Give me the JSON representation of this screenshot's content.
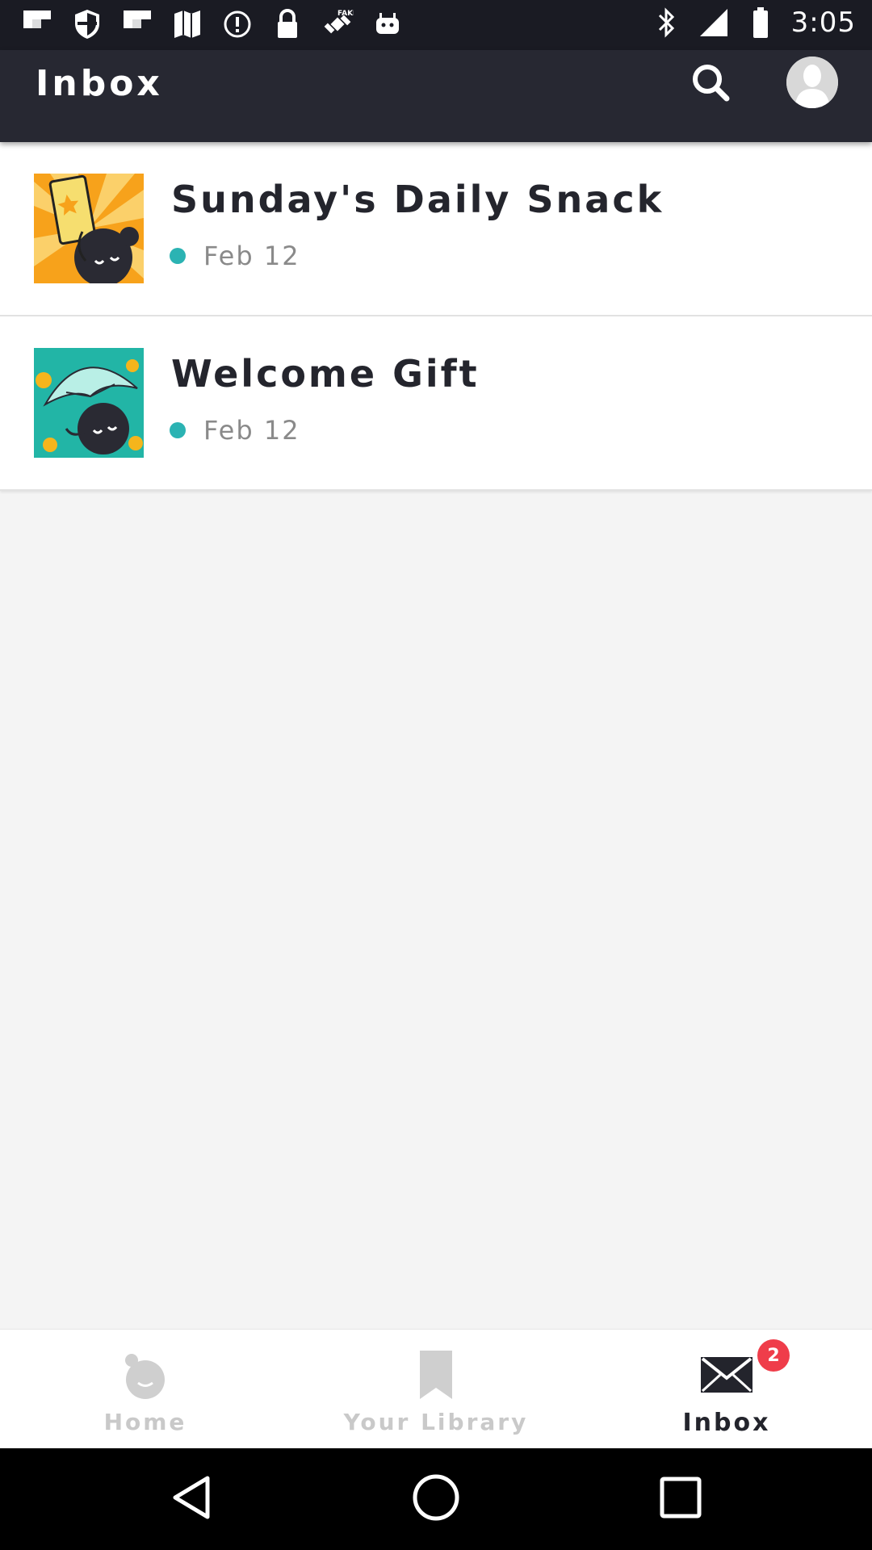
{
  "status_bar": {
    "time": "3:05",
    "icons": [
      "flipboard-icon",
      "shield-icon",
      "flipboard-icon",
      "maps-icon",
      "info-icon",
      "lock-icon",
      "satellite-icon",
      "android-icon",
      "bluetooth-icon",
      "signal-icon",
      "battery-icon"
    ]
  },
  "app_bar": {
    "title": "Inbox",
    "icons": [
      "search-icon",
      "profile-icon"
    ]
  },
  "messages": [
    {
      "title": "Sunday's Daily Snack",
      "date": "Feb 12",
      "unread": true,
      "dot_color": "#2bb3b3"
    },
    {
      "title": "Welcome Gift",
      "date": "Feb 12",
      "unread": true,
      "dot_color": "#2bb3b3"
    }
  ],
  "bottom_nav": {
    "items": [
      {
        "label": "Home",
        "icon": "home-icon",
        "active": false
      },
      {
        "label": "Your Library",
        "icon": "bookmark-icon",
        "active": false
      },
      {
        "label": "Inbox",
        "icon": "mail-icon",
        "active": true,
        "badge": "2"
      }
    ]
  },
  "system_nav": {
    "icons": [
      "back-icon",
      "home-circle-icon",
      "recents-icon"
    ]
  },
  "colors": {
    "app_bar": "#272832",
    "status_bar": "#1a1b23",
    "accent_dot": "#2bb3b3",
    "badge": "#ef3d4a",
    "background": "#f4f4f4"
  }
}
